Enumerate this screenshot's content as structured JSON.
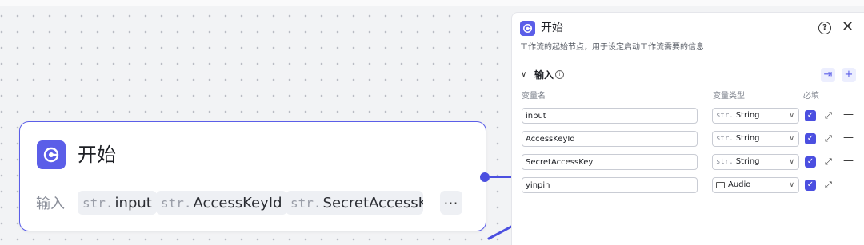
{
  "node": {
    "title": "开始",
    "input_label": "输入",
    "chips": [
      {
        "type": "str.",
        "name": "input"
      },
      {
        "type": "str.",
        "name": "AccessKeyId"
      },
      {
        "type": "str.",
        "name": "SecretAccessK"
      }
    ],
    "more": "···"
  },
  "panel": {
    "title": "开始",
    "description": "工作流的起始节点，用于设定启动工作流需要的信息",
    "help_icon": "?",
    "close_icon": "✕",
    "section": {
      "title": "输入",
      "info": "i",
      "collapse_icon": "∨",
      "import_icon": "⇥",
      "add_icon": "+"
    },
    "columns": {
      "name": "变量名",
      "type": "变量类型",
      "required": "必填"
    },
    "rows": [
      {
        "name": "input",
        "type_prefix": "str.",
        "type": "String"
      },
      {
        "name": "AccessKeyId",
        "type_prefix": "str.",
        "type": "String"
      },
      {
        "name": "SecretAccessKey",
        "type_prefix": "str.",
        "type": "String"
      },
      {
        "name": "yinpin",
        "type_prefix": "",
        "type": "Audio"
      }
    ]
  },
  "colors": {
    "accent": "#5b5ee8",
    "edge": "#4b4fe0"
  }
}
